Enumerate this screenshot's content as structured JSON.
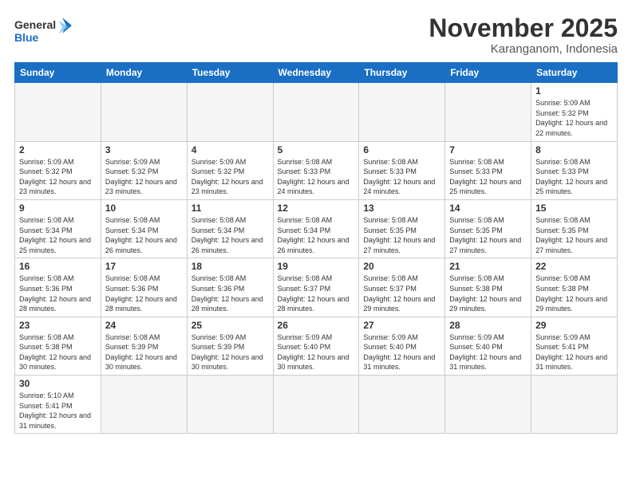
{
  "logo": {
    "text_general": "General",
    "text_blue": "Blue"
  },
  "header": {
    "month": "November 2025",
    "location": "Karanganom, Indonesia"
  },
  "weekdays": [
    "Sunday",
    "Monday",
    "Tuesday",
    "Wednesday",
    "Thursday",
    "Friday",
    "Saturday"
  ],
  "weeks": [
    [
      {
        "day": "",
        "info": ""
      },
      {
        "day": "",
        "info": ""
      },
      {
        "day": "",
        "info": ""
      },
      {
        "day": "",
        "info": ""
      },
      {
        "day": "",
        "info": ""
      },
      {
        "day": "",
        "info": ""
      },
      {
        "day": "1",
        "info": "Sunrise: 5:09 AM\nSunset: 5:32 PM\nDaylight: 12 hours and 22 minutes."
      }
    ],
    [
      {
        "day": "2",
        "info": "Sunrise: 5:09 AM\nSunset: 5:32 PM\nDaylight: 12 hours and 23 minutes."
      },
      {
        "day": "3",
        "info": "Sunrise: 5:09 AM\nSunset: 5:32 PM\nDaylight: 12 hours and 23 minutes."
      },
      {
        "day": "4",
        "info": "Sunrise: 5:09 AM\nSunset: 5:32 PM\nDaylight: 12 hours and 23 minutes."
      },
      {
        "day": "5",
        "info": "Sunrise: 5:08 AM\nSunset: 5:33 PM\nDaylight: 12 hours and 24 minutes."
      },
      {
        "day": "6",
        "info": "Sunrise: 5:08 AM\nSunset: 5:33 PM\nDaylight: 12 hours and 24 minutes."
      },
      {
        "day": "7",
        "info": "Sunrise: 5:08 AM\nSunset: 5:33 PM\nDaylight: 12 hours and 25 minutes."
      },
      {
        "day": "8",
        "info": "Sunrise: 5:08 AM\nSunset: 5:33 PM\nDaylight: 12 hours and 25 minutes."
      }
    ],
    [
      {
        "day": "9",
        "info": "Sunrise: 5:08 AM\nSunset: 5:34 PM\nDaylight: 12 hours and 25 minutes."
      },
      {
        "day": "10",
        "info": "Sunrise: 5:08 AM\nSunset: 5:34 PM\nDaylight: 12 hours and 26 minutes."
      },
      {
        "day": "11",
        "info": "Sunrise: 5:08 AM\nSunset: 5:34 PM\nDaylight: 12 hours and 26 minutes."
      },
      {
        "day": "12",
        "info": "Sunrise: 5:08 AM\nSunset: 5:34 PM\nDaylight: 12 hours and 26 minutes."
      },
      {
        "day": "13",
        "info": "Sunrise: 5:08 AM\nSunset: 5:35 PM\nDaylight: 12 hours and 27 minutes."
      },
      {
        "day": "14",
        "info": "Sunrise: 5:08 AM\nSunset: 5:35 PM\nDaylight: 12 hours and 27 minutes."
      },
      {
        "day": "15",
        "info": "Sunrise: 5:08 AM\nSunset: 5:35 PM\nDaylight: 12 hours and 27 minutes."
      }
    ],
    [
      {
        "day": "16",
        "info": "Sunrise: 5:08 AM\nSunset: 5:36 PM\nDaylight: 12 hours and 28 minutes."
      },
      {
        "day": "17",
        "info": "Sunrise: 5:08 AM\nSunset: 5:36 PM\nDaylight: 12 hours and 28 minutes."
      },
      {
        "day": "18",
        "info": "Sunrise: 5:08 AM\nSunset: 5:36 PM\nDaylight: 12 hours and 28 minutes."
      },
      {
        "day": "19",
        "info": "Sunrise: 5:08 AM\nSunset: 5:37 PM\nDaylight: 12 hours and 28 minutes."
      },
      {
        "day": "20",
        "info": "Sunrise: 5:08 AM\nSunset: 5:37 PM\nDaylight: 12 hours and 29 minutes."
      },
      {
        "day": "21",
        "info": "Sunrise: 5:08 AM\nSunset: 5:38 PM\nDaylight: 12 hours and 29 minutes."
      },
      {
        "day": "22",
        "info": "Sunrise: 5:08 AM\nSunset: 5:38 PM\nDaylight: 12 hours and 29 minutes."
      }
    ],
    [
      {
        "day": "23",
        "info": "Sunrise: 5:08 AM\nSunset: 5:38 PM\nDaylight: 12 hours and 30 minutes."
      },
      {
        "day": "24",
        "info": "Sunrise: 5:08 AM\nSunset: 5:39 PM\nDaylight: 12 hours and 30 minutes."
      },
      {
        "day": "25",
        "info": "Sunrise: 5:09 AM\nSunset: 5:39 PM\nDaylight: 12 hours and 30 minutes."
      },
      {
        "day": "26",
        "info": "Sunrise: 5:09 AM\nSunset: 5:40 PM\nDaylight: 12 hours and 30 minutes."
      },
      {
        "day": "27",
        "info": "Sunrise: 5:09 AM\nSunset: 5:40 PM\nDaylight: 12 hours and 31 minutes."
      },
      {
        "day": "28",
        "info": "Sunrise: 5:09 AM\nSunset: 5:40 PM\nDaylight: 12 hours and 31 minutes."
      },
      {
        "day": "29",
        "info": "Sunrise: 5:09 AM\nSunset: 5:41 PM\nDaylight: 12 hours and 31 minutes."
      }
    ],
    [
      {
        "day": "30",
        "info": "Sunrise: 5:10 AM\nSunset: 5:41 PM\nDaylight: 12 hours and 31 minutes."
      },
      {
        "day": "",
        "info": ""
      },
      {
        "day": "",
        "info": ""
      },
      {
        "day": "",
        "info": ""
      },
      {
        "day": "",
        "info": ""
      },
      {
        "day": "",
        "info": ""
      },
      {
        "day": "",
        "info": ""
      }
    ]
  ]
}
